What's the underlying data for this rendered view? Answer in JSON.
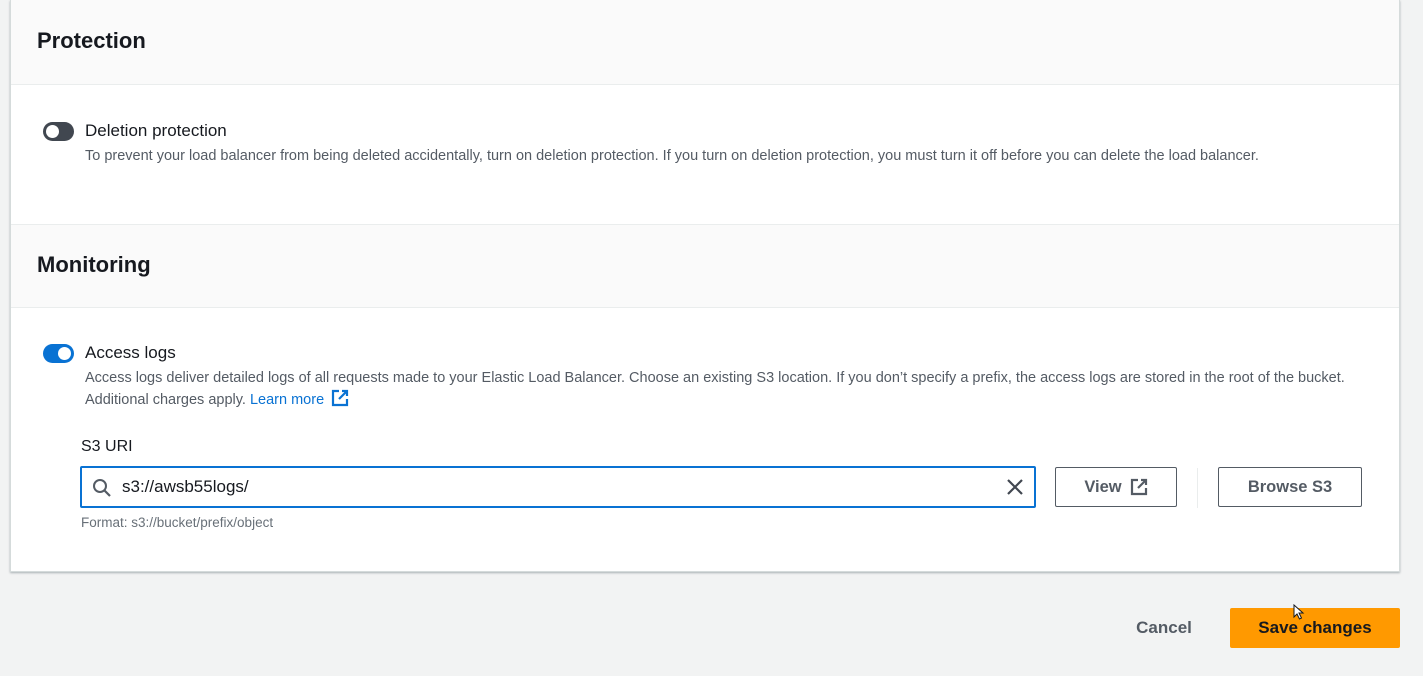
{
  "protection": {
    "title": "Protection",
    "deletion_protection": {
      "label": "Deletion protection",
      "enabled": false,
      "description": "To prevent your load balancer from being deleted accidentally, turn on deletion protection. If you turn on deletion protection, you must turn it off before you can delete the load balancer."
    }
  },
  "monitoring": {
    "title": "Monitoring",
    "access_logs": {
      "label": "Access logs",
      "enabled": true,
      "description": "Access logs deliver detailed logs of all requests made to your Elastic Load Balancer. Choose an existing S3 location. If you don’t specify a prefix, the access logs are stored in the root of the bucket. Additional charges apply.",
      "learn_more": "Learn more"
    },
    "s3_uri": {
      "label": "S3 URI",
      "value": "s3://awsb55logs/",
      "hint": "Format: s3://bucket/prefix/object",
      "view_label": "View",
      "browse_label": "Browse S3"
    }
  },
  "footer": {
    "cancel_label": "Cancel",
    "save_label": "Save changes"
  },
  "colors": {
    "accent": "#0972d3",
    "primary_button": "#ff9900",
    "background": "#f2f3f3"
  },
  "icons": [
    "search-icon",
    "clear-icon",
    "external-link-icon",
    "cursor-icon"
  ]
}
